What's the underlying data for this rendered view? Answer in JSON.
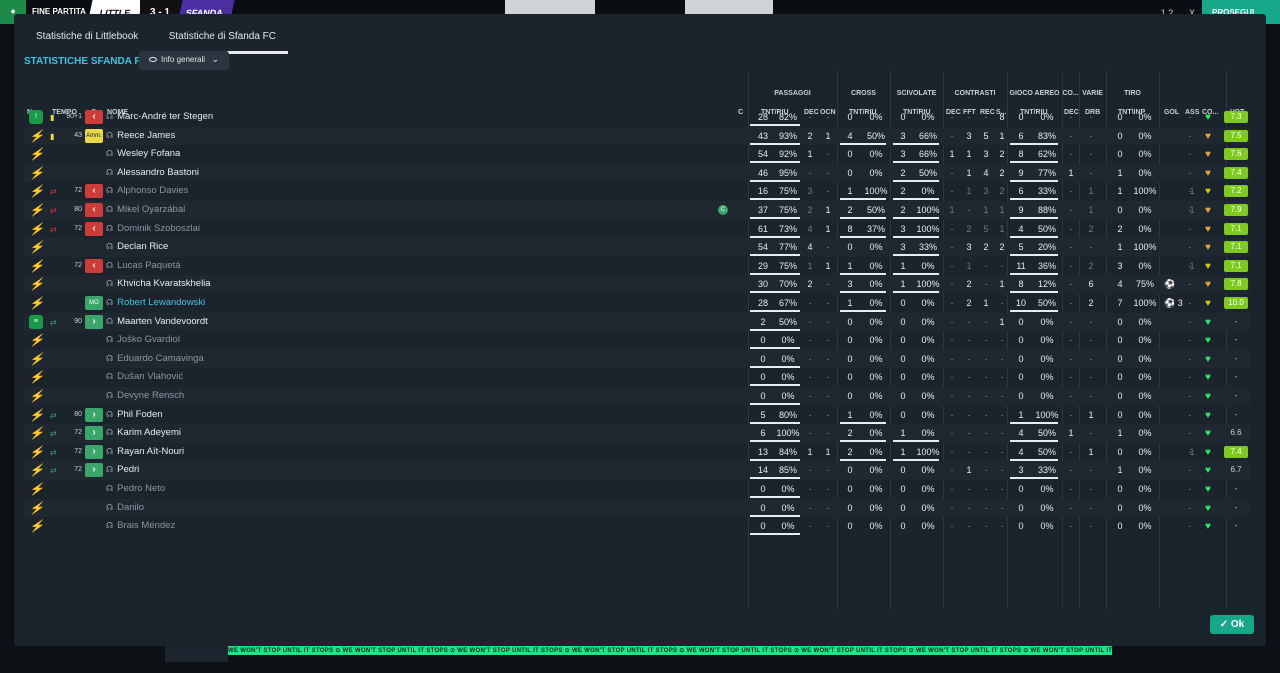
{
  "topbar": {
    "end_label": "FINE PARTITA",
    "home_team": "LITTLE",
    "score": "3 - 1",
    "away_team": "SFANDA",
    "ratio": "1.2",
    "close": "X",
    "continue_label": "PROSEGUI"
  },
  "tabs": [
    {
      "label": "Statistiche di Littlebook",
      "active": false
    },
    {
      "label": "Statistiche di Sfanda FC",
      "active": true
    }
  ],
  "heading": "STATISTICHE SFANDA FC",
  "view_dropdown": "Info generali",
  "groups": [
    "PASSAGGI",
    "CROSS",
    "SCIVOLATE",
    "CONTRASTI",
    "GIOCO AEREO",
    "CO...",
    "VARIE",
    "TIRO"
  ],
  "columns": {
    "num": "N.",
    "time": "TEMPO",
    "c": "C",
    "name": "NOME",
    "c2": "C",
    "pass_tr": "TNT/RIU",
    "pass_dec": "DEC",
    "pass_ocn": "OCN",
    "cross_tr": "TNT/RIU",
    "tack_tr": "TNT/RIU",
    "con_dec": "DEC",
    "con_fft": "FFT",
    "con_rec": "REC",
    "con_s": "S...",
    "air_tr": "TNT/RIU",
    "co_dec": "DEC",
    "drb": "DRB",
    "shot_tr": "TNT\\INP",
    "gol": "GOL",
    "ass": "ASS",
    "co2": "CO...",
    "vot": "VOT"
  },
  "players": [
    {
      "badge": "!",
      "badge_type": "green",
      "minute": "90+1",
      "event": "yellow",
      "sub": "off",
      "tag": "",
      "name": "Marc-André ter Stegen",
      "starter": true,
      "extra_icon": "",
      "p": "28",
      "pp": "82%",
      "pdec": "-",
      "pocn": "-",
      "c": "0",
      "cp": "0%",
      "t": "0",
      "tp": "0%",
      "cdec": "-",
      "cfft": "-",
      "crec": "-",
      "cs": "8",
      "a": "0",
      "ap": "0%",
      "codec": "-",
      "drb": "-",
      "s": "0",
      "sp": "0%",
      "gol": "",
      "ass": "-",
      "rating": "7.3",
      "heart": "green"
    },
    {
      "badge": "",
      "badge_type": "blue",
      "minute": "43",
      "event": "yellow",
      "sub": "",
      "tag": "Amm.",
      "name": "Reece James",
      "starter": true,
      "extra_icon": "",
      "p": "43",
      "pp": "93%",
      "pdec": "2",
      "pocn": "1",
      "c": "4",
      "cp": "50%",
      "t": "3",
      "tp": "66%",
      "cdec": "-",
      "cfft": "3",
      "crec": "5",
      "cs": "1",
      "a": "6",
      "ap": "83%",
      "codec": "-",
      "drb": "-",
      "s": "0",
      "sp": "0%",
      "gol": "",
      "ass": "-",
      "rating": "7.5",
      "heart": "orange"
    },
    {
      "badge": "",
      "badge_type": "blue",
      "minute": "",
      "event": "",
      "sub": "",
      "tag": "",
      "name": "Wesley Fofana",
      "starter": true,
      "extra_icon": "",
      "p": "54",
      "pp": "92%",
      "pdec": "1",
      "pocn": "-",
      "c": "0",
      "cp": "0%",
      "t": "3",
      "tp": "66%",
      "cdec": "1",
      "cfft": "1",
      "crec": "3",
      "cs": "2",
      "a": "8",
      "ap": "62%",
      "codec": "-",
      "drb": "-",
      "s": "0",
      "sp": "0%",
      "gol": "",
      "ass": "-",
      "rating": "7.6",
      "heart": "orange"
    },
    {
      "badge": "",
      "badge_type": "blue",
      "minute": "",
      "event": "",
      "sub": "",
      "tag": "",
      "name": "Alessandro Bastoni",
      "starter": true,
      "extra_icon": "",
      "p": "46",
      "pp": "95%",
      "pdec": "-",
      "pocn": "-",
      "c": "0",
      "cp": "0%",
      "t": "2",
      "tp": "50%",
      "cdec": "-",
      "cfft": "1",
      "crec": "4",
      "cs": "2",
      "a": "9",
      "ap": "77%",
      "codec": "1",
      "drb": "-",
      "s": "1",
      "sp": "0%",
      "gol": "",
      "ass": "-",
      "rating": "7.4",
      "heart": "orange"
    },
    {
      "badge": "",
      "badge_type": "blue",
      "minute": "72",
      "event": "sub",
      "sub": "off",
      "tag": "",
      "name": "Alphonso Davies",
      "starter": false,
      "extra_icon": "",
      "p": "16",
      "pp": "75%",
      "pdec": "3",
      "pocn": "-",
      "c": "1",
      "cp": "100%",
      "t": "2",
      "tp": "0%",
      "cdec": "-",
      "cfft": "1",
      "crec": "3",
      "cs": "2",
      "a": "6",
      "ap": "33%",
      "codec": "-",
      "drb": "1",
      "s": "1",
      "sp": "100%",
      "gol": "1",
      "ass": "-",
      "rating": "7.2",
      "heart": "yellow"
    },
    {
      "badge": "",
      "badge_type": "blue",
      "minute": "80",
      "event": "sub",
      "sub": "off",
      "tag": "",
      "name": "Mikel Oyarzábal",
      "starter": false,
      "extra_icon": "c",
      "p": "37",
      "pp": "75%",
      "pdec": "2",
      "pocn": "1",
      "c": "2",
      "cp": "50%",
      "t": "2",
      "tp": "100%",
      "cdec": "1",
      "cfft": "-",
      "crec": "1",
      "cs": "1",
      "a": "9",
      "ap": "88%",
      "codec": "-",
      "drb": "1",
      "s": "0",
      "sp": "0%",
      "gol": "1",
      "ass": "-",
      "rating": "7.9",
      "heart": "orange"
    },
    {
      "badge": "",
      "badge_type": "blue",
      "minute": "72",
      "event": "sub",
      "sub": "off",
      "tag": "",
      "name": "Dominik Szoboszlai",
      "starter": false,
      "extra_icon": "",
      "p": "61",
      "pp": "73%",
      "pdec": "4",
      "pocn": "1",
      "c": "8",
      "cp": "37%",
      "t": "3",
      "tp": "100%",
      "cdec": "-",
      "cfft": "2",
      "crec": "5",
      "cs": "1",
      "a": "4",
      "ap": "50%",
      "codec": "-",
      "drb": "2",
      "s": "2",
      "sp": "0%",
      "gol": "",
      "ass": "-",
      "rating": "7.1",
      "heart": "orange"
    },
    {
      "badge": "",
      "badge_type": "blue",
      "minute": "",
      "event": "",
      "sub": "",
      "tag": "",
      "name": "Declan Rice",
      "starter": true,
      "extra_icon": "",
      "p": "54",
      "pp": "77%",
      "pdec": "4",
      "pocn": "-",
      "c": "0",
      "cp": "0%",
      "t": "3",
      "tp": "33%",
      "cdec": "-",
      "cfft": "3",
      "crec": "2",
      "cs": "2",
      "a": "5",
      "ap": "20%",
      "codec": "-",
      "drb": "-",
      "s": "1",
      "sp": "100%",
      "gol": "",
      "ass": "-",
      "rating": "7.1",
      "heart": "orange"
    },
    {
      "badge": "",
      "badge_type": "blue",
      "minute": "72",
      "event": "",
      "sub": "off",
      "tag": "",
      "name": "Lucas Paquetá",
      "starter": false,
      "extra_icon": "",
      "p": "29",
      "pp": "75%",
      "pdec": "1",
      "pocn": "1",
      "c": "1",
      "cp": "0%",
      "t": "1",
      "tp": "0%",
      "cdec": "-",
      "cfft": "1",
      "crec": "-",
      "cs": "-",
      "a": "11",
      "ap": "36%",
      "codec": "-",
      "drb": "2",
      "s": "3",
      "sp": "0%",
      "gol": "1",
      "ass": "-",
      "rating": "7.1",
      "heart": "yellow"
    },
    {
      "badge": "",
      "badge_type": "blue",
      "minute": "",
      "event": "",
      "sub": "",
      "tag": "",
      "name": "Khvicha Kvaratskhelia",
      "starter": true,
      "extra_icon": "",
      "p": "30",
      "pp": "70%",
      "pdec": "2",
      "pocn": "-",
      "c": "3",
      "cp": "0%",
      "t": "1",
      "tp": "100%",
      "cdec": "-",
      "cfft": "2",
      "crec": "-",
      "cs": "1",
      "a": "8",
      "ap": "12%",
      "codec": "-",
      "drb": "6",
      "s": "4",
      "sp": "75%",
      "gol": "ball",
      "ass": "-",
      "rating": "7.8",
      "heart": "orange"
    },
    {
      "badge": "",
      "badge_type": "blue",
      "minute": "",
      "event": "",
      "sub": "",
      "tag": "MO",
      "name": "Robert Lewandowski",
      "starter": true,
      "highlight": true,
      "extra_icon": "",
      "p": "28",
      "pp": "67%",
      "pdec": "-",
      "pocn": "-",
      "c": "1",
      "cp": "0%",
      "t": "0",
      "tp": "0%",
      "cdec": "-",
      "cfft": "2",
      "crec": "1",
      "cs": "-",
      "a": "10",
      "ap": "50%",
      "codec": "-",
      "drb": "2",
      "s": "7",
      "sp": "100%",
      "gol": "ball3",
      "ass": "-",
      "rating": "10.0",
      "heart": "yellow"
    },
    {
      "badge": "",
      "badge_type": "green",
      "minute": "90",
      "event": "sub",
      "sub": "on",
      "tag": "",
      "name": "Maarten Vandevoordt",
      "starter": true,
      "extra_icon": "",
      "p": "2",
      "pp": "50%",
      "pdec": "-",
      "pocn": "-",
      "c": "0",
      "cp": "0%",
      "t": "0",
      "tp": "0%",
      "cdec": "-",
      "cfft": "-",
      "crec": "-",
      "cs": "1",
      "a": "0",
      "ap": "0%",
      "codec": "-",
      "drb": "-",
      "s": "0",
      "sp": "0%",
      "gol": "",
      "ass": "-",
      "rating": "-",
      "heart": "green"
    },
    {
      "badge": "",
      "badge_type": "blue",
      "minute": "",
      "event": "",
      "sub": "",
      "tag": "",
      "name": "Joško Gvardiol",
      "starter": false,
      "extra_icon": "",
      "p": "0",
      "pp": "0%",
      "pdec": "-",
      "pocn": "-",
      "c": "0",
      "cp": "0%",
      "t": "0",
      "tp": "0%",
      "cdec": "-",
      "cfft": "-",
      "crec": "-",
      "cs": "-",
      "a": "0",
      "ap": "0%",
      "codec": "-",
      "drb": "-",
      "s": "0",
      "sp": "0%",
      "gol": "",
      "ass": "-",
      "rating": "-",
      "heart": "green"
    },
    {
      "badge": "",
      "badge_type": "blue",
      "minute": "",
      "event": "",
      "sub": "",
      "tag": "",
      "name": "Eduardo Camavinga",
      "starter": false,
      "extra_icon": "",
      "p": "0",
      "pp": "0%",
      "pdec": "-",
      "pocn": "-",
      "c": "0",
      "cp": "0%",
      "t": "0",
      "tp": "0%",
      "cdec": "-",
      "cfft": "-",
      "crec": "-",
      "cs": "-",
      "a": "0",
      "ap": "0%",
      "codec": "-",
      "drb": "-",
      "s": "0",
      "sp": "0%",
      "gol": "",
      "ass": "-",
      "rating": "-",
      "heart": "green"
    },
    {
      "badge": "",
      "badge_type": "blue",
      "minute": "",
      "event": "",
      "sub": "",
      "tag": "",
      "name": "Dušan Vlahović",
      "starter": false,
      "extra_icon": "",
      "p": "0",
      "pp": "0%",
      "pdec": "-",
      "pocn": "-",
      "c": "0",
      "cp": "0%",
      "t": "0",
      "tp": "0%",
      "cdec": "-",
      "cfft": "-",
      "crec": "-",
      "cs": "-",
      "a": "0",
      "ap": "0%",
      "codec": "-",
      "drb": "-",
      "s": "0",
      "sp": "0%",
      "gol": "",
      "ass": "-",
      "rating": "-",
      "heart": "green"
    },
    {
      "badge": "",
      "badge_type": "blue",
      "minute": "",
      "event": "",
      "sub": "",
      "tag": "",
      "name": "Devyne Rensch",
      "starter": false,
      "extra_icon": "",
      "p": "0",
      "pp": "0%",
      "pdec": "-",
      "pocn": "-",
      "c": "0",
      "cp": "0%",
      "t": "0",
      "tp": "0%",
      "cdec": "-",
      "cfft": "-",
      "crec": "-",
      "cs": "-",
      "a": "0",
      "ap": "0%",
      "codec": "-",
      "drb": "-",
      "s": "0",
      "sp": "0%",
      "gol": "",
      "ass": "-",
      "rating": "-",
      "heart": "green"
    },
    {
      "badge": "",
      "badge_type": "blue",
      "minute": "80",
      "event": "sub",
      "sub": "on",
      "tag": "",
      "name": "Phil Foden",
      "starter": true,
      "extra_icon": "",
      "p": "5",
      "pp": "80%",
      "pdec": "-",
      "pocn": "-",
      "c": "1",
      "cp": "0%",
      "t": "0",
      "tp": "0%",
      "cdec": "-",
      "cfft": "-",
      "crec": "-",
      "cs": "-",
      "a": "1",
      "ap": "100%",
      "codec": "-",
      "drb": "1",
      "s": "0",
      "sp": "0%",
      "gol": "",
      "ass": "-",
      "rating": "-",
      "heart": "green"
    },
    {
      "badge": "",
      "badge_type": "blue",
      "minute": "72",
      "event": "sub",
      "sub": "on",
      "tag": "",
      "name": "Karim Adeyemi",
      "starter": true,
      "extra_icon": "",
      "p": "6",
      "pp": "100%",
      "pdec": "-",
      "pocn": "-",
      "c": "2",
      "cp": "0%",
      "t": "1",
      "tp": "0%",
      "cdec": "-",
      "cfft": "-",
      "crec": "-",
      "cs": "-",
      "a": "4",
      "ap": "50%",
      "codec": "1",
      "drb": "-",
      "s": "1",
      "sp": "0%",
      "gol": "",
      "ass": "-",
      "rating": "6.6",
      "heart": "green"
    },
    {
      "badge": "",
      "badge_type": "blue",
      "minute": "72",
      "event": "sub",
      "sub": "on",
      "tag": "",
      "name": "Rayan Aït-Nouri",
      "starter": true,
      "extra_icon": "",
      "p": "13",
      "pp": "84%",
      "pdec": "1",
      "pocn": "1",
      "c": "2",
      "cp": "0%",
      "t": "1",
      "tp": "100%",
      "cdec": "-",
      "cfft": "-",
      "crec": "-",
      "cs": "-",
      "a": "4",
      "ap": "50%",
      "codec": "-",
      "drb": "1",
      "s": "0",
      "sp": "0%",
      "gol": "1",
      "ass": "-",
      "rating": "7.4",
      "heart": "green"
    },
    {
      "badge": "",
      "badge_type": "blue",
      "minute": "72",
      "event": "sub",
      "sub": "on",
      "tag": "",
      "name": "Pedri",
      "starter": true,
      "extra_icon": "",
      "p": "14",
      "pp": "85%",
      "pdec": "-",
      "pocn": "-",
      "c": "0",
      "cp": "0%",
      "t": "0",
      "tp": "0%",
      "cdec": "-",
      "cfft": "1",
      "crec": "-",
      "cs": "-",
      "a": "3",
      "ap": "33%",
      "codec": "-",
      "drb": "-",
      "s": "1",
      "sp": "0%",
      "gol": "",
      "ass": "-",
      "rating": "6.7",
      "heart": "green"
    },
    {
      "badge": "",
      "badge_type": "blue",
      "minute": "",
      "event": "",
      "sub": "",
      "tag": "",
      "name": "Pedro Neto",
      "starter": false,
      "extra_icon": "",
      "p": "0",
      "pp": "0%",
      "pdec": "-",
      "pocn": "-",
      "c": "0",
      "cp": "0%",
      "t": "0",
      "tp": "0%",
      "cdec": "-",
      "cfft": "-",
      "crec": "-",
      "cs": "-",
      "a": "0",
      "ap": "0%",
      "codec": "-",
      "drb": "-",
      "s": "0",
      "sp": "0%",
      "gol": "",
      "ass": "-",
      "rating": "-",
      "heart": "green"
    },
    {
      "badge": "",
      "badge_type": "blue",
      "minute": "",
      "event": "",
      "sub": "",
      "tag": "",
      "name": "Danilo",
      "starter": false,
      "extra_icon": "",
      "p": "0",
      "pp": "0%",
      "pdec": "-",
      "pocn": "-",
      "c": "0",
      "cp": "0%",
      "t": "0",
      "tp": "0%",
      "cdec": "-",
      "cfft": "-",
      "crec": "-",
      "cs": "-",
      "a": "0",
      "ap": "0%",
      "codec": "-",
      "drb": "-",
      "s": "0",
      "sp": "0%",
      "gol": "",
      "ass": "-",
      "rating": "-",
      "heart": "green"
    },
    {
      "badge": "",
      "badge_type": "blue",
      "minute": "",
      "event": "",
      "sub": "",
      "tag": "",
      "name": "Brais Méndez",
      "starter": false,
      "extra_icon": "",
      "p": "0",
      "pp": "0%",
      "pdec": "-",
      "pocn": "-",
      "c": "0",
      "cp": "0%",
      "t": "0",
      "tp": "0%",
      "cdec": "-",
      "cfft": "-",
      "crec": "-",
      "cs": "-",
      "a": "0",
      "ap": "0%",
      "codec": "-",
      "drb": "-",
      "s": "0",
      "sp": "0%",
      "gol": "",
      "ass": "-",
      "rating": "-",
      "heart": "green"
    }
  ],
  "ok_label": "Ok",
  "ticker_text": "WE WON'T STOP UNTIL IT STOPS  ⊙  WE WON'T STOP UNTIL IT STOPS  ⊙  WE WON'T STOP UNTIL IT STOPS  ⊙  WE WON'T STOP UNTIL IT STOPS  ⊙  WE WON'T STOP UNTIL IT STOPS  ⊙  WE WON'T STOP UNTIL IT STOPS  ⊙  WE WON'T STOP UNTIL IT STOPS  ⊙  WE WON'T STOP UNTIL IT STOPS  ⊙  WE WON'T STOP UNTIL IT STOPS",
  "colors": {
    "accent": "#3fc3dd",
    "ok": "#17a88a",
    "sub_off": "#cf3b3b",
    "sub_on": "#3aa66a",
    "rating": "#7ecb1e"
  }
}
